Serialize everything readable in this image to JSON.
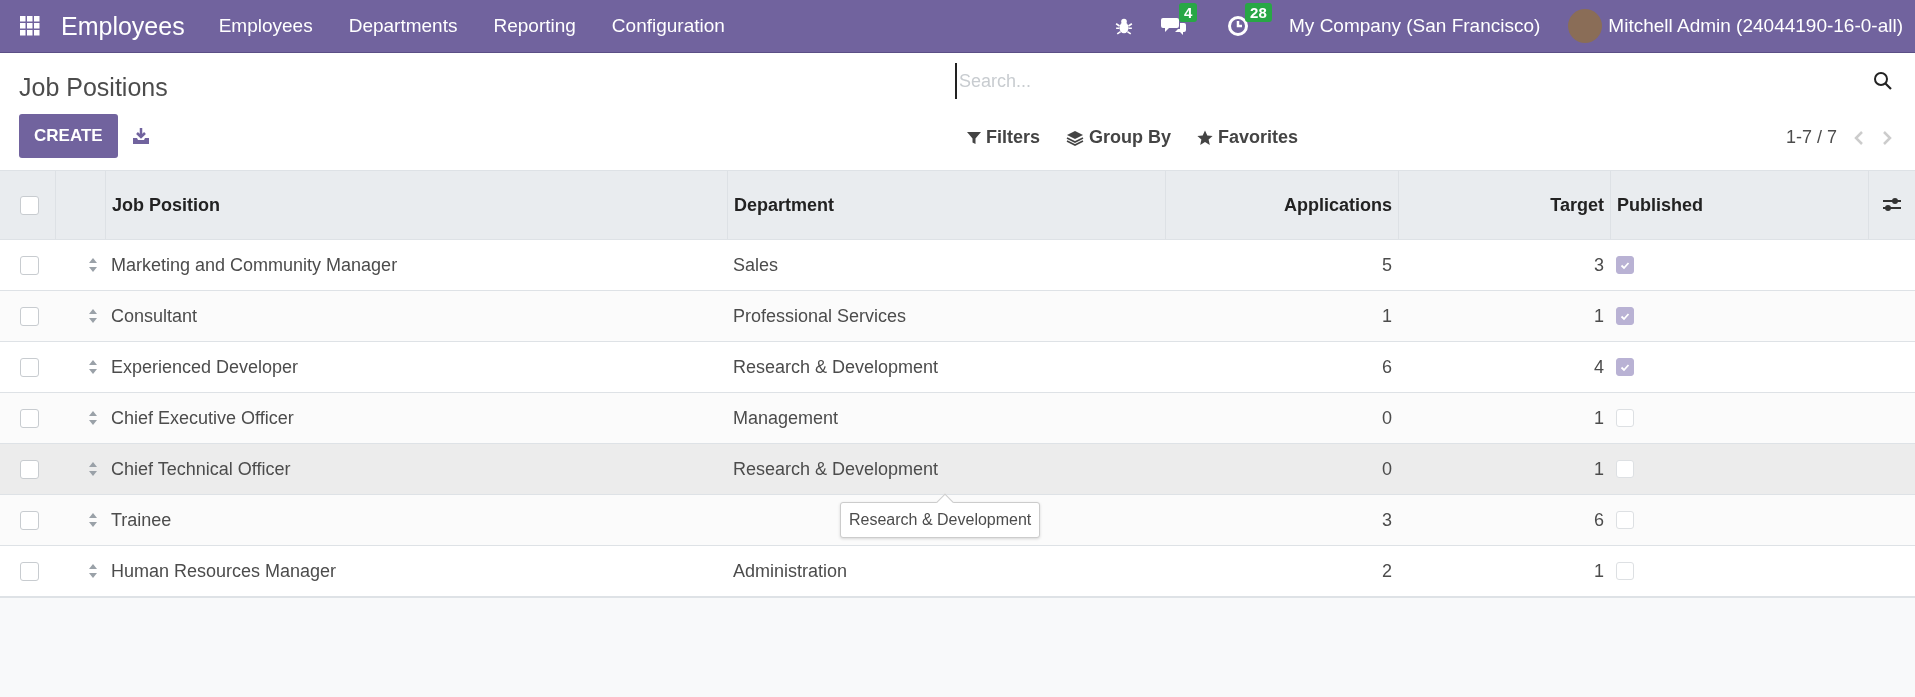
{
  "navbar": {
    "app_name": "Employees",
    "menu": [
      "Employees",
      "Departments",
      "Reporting",
      "Configuration"
    ],
    "messages_badge": "4",
    "activities_badge": "28",
    "company": "My Company (San Francisco)",
    "user": "Mitchell Admin (24044190-16-0-all)"
  },
  "control_panel": {
    "title": "Job Positions",
    "create_button": "CREATE",
    "search": {
      "placeholder": "Search..."
    },
    "filters": [
      "Filters",
      "Group By",
      "Favorites"
    ],
    "pager": "1-7 / 7"
  },
  "table": {
    "select_all_checked": false,
    "columns": [
      "Job Position",
      "Department",
      "Applications",
      "Target",
      "Published"
    ],
    "rows": [
      {
        "job_position": "Marketing and Community Manager",
        "department": "Sales",
        "applications": "5",
        "target": "3",
        "published": true,
        "hovered": false,
        "checked": false
      },
      {
        "job_position": "Consultant",
        "department": "Professional Services",
        "applications": "1",
        "target": "1",
        "published": true,
        "hovered": false,
        "checked": false
      },
      {
        "job_position": "Experienced Developer",
        "department": "Research & Development",
        "applications": "6",
        "target": "4",
        "published": true,
        "hovered": false,
        "checked": false
      },
      {
        "job_position": "Chief Executive Officer",
        "department": "Management",
        "applications": "0",
        "target": "1",
        "published": false,
        "hovered": false,
        "checked": false
      },
      {
        "job_position": "Chief Technical Officer",
        "department": "Research & Development",
        "applications": "0",
        "target": "1",
        "published": false,
        "hovered": true,
        "checked": false,
        "tooltip": "Research & Development"
      },
      {
        "job_position": "Trainee",
        "applications": "3",
        "target": "6",
        "published": false,
        "hovered": false,
        "checked": false
      },
      {
        "job_position": "Human Resources Manager",
        "department": "Administration",
        "applications": "2",
        "target": "1",
        "published": false,
        "hovered": false,
        "checked": false
      }
    ]
  }
}
